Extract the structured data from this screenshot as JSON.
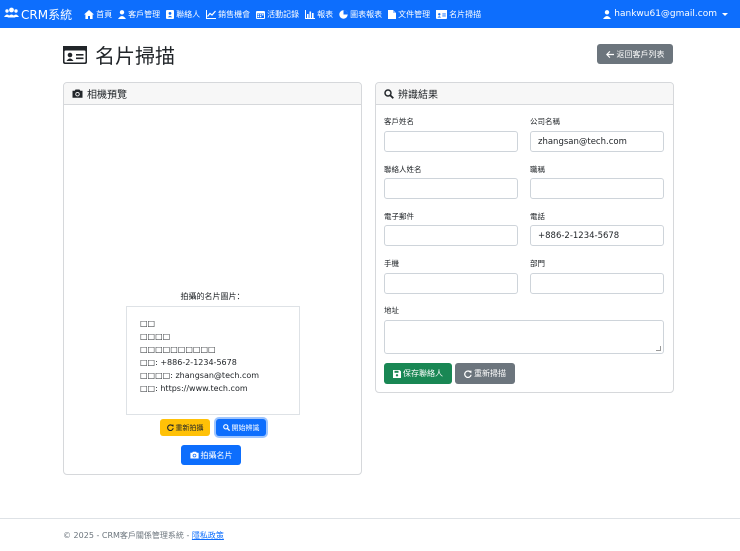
{
  "navbar": {
    "brand": "CRM系統",
    "items": [
      {
        "label": "首頁",
        "icon": "home-icon"
      },
      {
        "label": "客戶管理",
        "icon": "user-icon"
      },
      {
        "label": "聯絡人",
        "icon": "address-book-icon"
      },
      {
        "label": "銷售機會",
        "icon": "chart-line-icon"
      },
      {
        "label": "活動記錄",
        "icon": "calendar-icon"
      },
      {
        "label": "報表",
        "icon": "bar-chart-icon"
      },
      {
        "label": "圖表報表",
        "icon": "pie-chart-icon"
      },
      {
        "label": "文件管理",
        "icon": "folder-icon"
      },
      {
        "label": "名片掃描",
        "icon": "id-card-icon"
      }
    ],
    "user": "hankwu61@gmail.com"
  },
  "page": {
    "title": "名片掃描",
    "back_label": "返回客戶列表"
  },
  "camera": {
    "header": "相機預覽",
    "preview_label": "拍攝的名片圖片：",
    "card_lines": [
      "□□",
      "□□□□",
      "□□□□□□□□□□",
      "□□: +886-2-1234-5678",
      "□□□□: zhangsan@tech.com",
      "□□: https://www.tech.com"
    ],
    "retake_label": "重新拍攝",
    "recognize_label": "開始辨識",
    "capture_label": "拍攝名片"
  },
  "result": {
    "header": "辨識結果",
    "fields": {
      "customer_name": {
        "label": "客戶姓名",
        "value": ""
      },
      "company_name": {
        "label": "公司名稱",
        "value": "zhangsan@tech.com"
      },
      "contact_name": {
        "label": "聯絡人姓名",
        "value": ""
      },
      "job_title": {
        "label": "職稱",
        "value": ""
      },
      "email": {
        "label": "電子郵件",
        "value": ""
      },
      "phone": {
        "label": "電話",
        "value": "+886-2-1234-5678"
      },
      "mobile": {
        "label": "手機",
        "value": ""
      },
      "department": {
        "label": "部門",
        "value": ""
      },
      "address": {
        "label": "地址",
        "value": ""
      }
    },
    "save_label": "保存聯絡人",
    "rescan_label": "重新掃描"
  },
  "footer": {
    "text": "© 2025 - CRM客戶關係管理系統 - ",
    "privacy_link": "隱私政策"
  },
  "colors": {
    "primary": "#0d6efd",
    "secondary": "#6c757d",
    "success": "#198754",
    "warning": "#ffc107"
  }
}
